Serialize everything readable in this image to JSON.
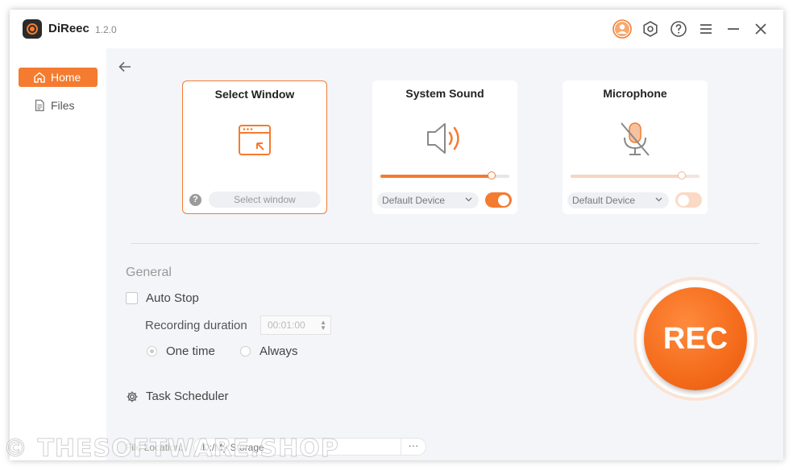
{
  "app": {
    "title": "DiReec",
    "version": "1.2.0"
  },
  "titlebar_icons": [
    "account-icon",
    "settings-icon",
    "help-icon",
    "menu-icon",
    "minimize-icon",
    "close-icon"
  ],
  "sidebar": {
    "items": [
      {
        "label": "Home",
        "icon": "home-icon",
        "active": true
      },
      {
        "label": "Files",
        "icon": "file-icon",
        "active": false
      }
    ]
  },
  "sources": {
    "select_window": {
      "title": "Select Window",
      "button": "Select window",
      "help": "?"
    },
    "system_sound": {
      "title": "System Sound",
      "device": "Default Device",
      "volume": 0.86,
      "enabled": true
    },
    "microphone": {
      "title": "Microphone",
      "device": "Default Device",
      "volume": 0.86,
      "enabled": false,
      "muted": true
    }
  },
  "general": {
    "title": "General",
    "auto_stop": {
      "label": "Auto Stop",
      "checked": false
    },
    "recording_duration": {
      "label": "Recording duration",
      "value": "00:01:00"
    },
    "frequency": {
      "options": [
        "One time",
        "Always"
      ],
      "selected": "One time"
    },
    "task_scheduler": "Task Scheduler",
    "file_location": {
      "label": "File Location:",
      "value": "D:/My Storage",
      "more": "···"
    }
  },
  "rec_button": "REC",
  "watermark": "© THESOFTWARE.SHOP",
  "colors": {
    "accent": "#f47b30",
    "background": "#f4f5f9"
  }
}
